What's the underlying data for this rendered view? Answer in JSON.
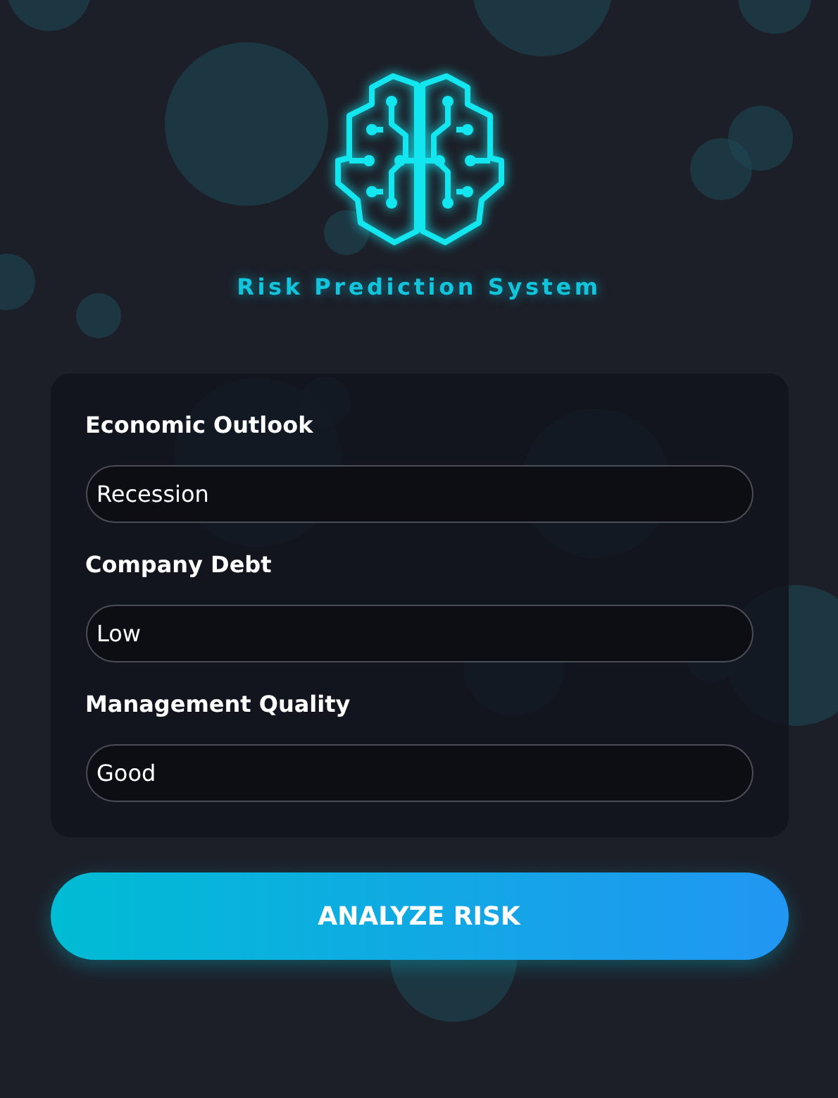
{
  "title": "Risk Prediction System",
  "fields": [
    {
      "label": "Economic Outlook",
      "value": "Recession"
    },
    {
      "label": "Company Debt",
      "value": "Low"
    },
    {
      "label": "Management Quality",
      "value": "Good"
    }
  ],
  "button": "ANALYZE RISK"
}
